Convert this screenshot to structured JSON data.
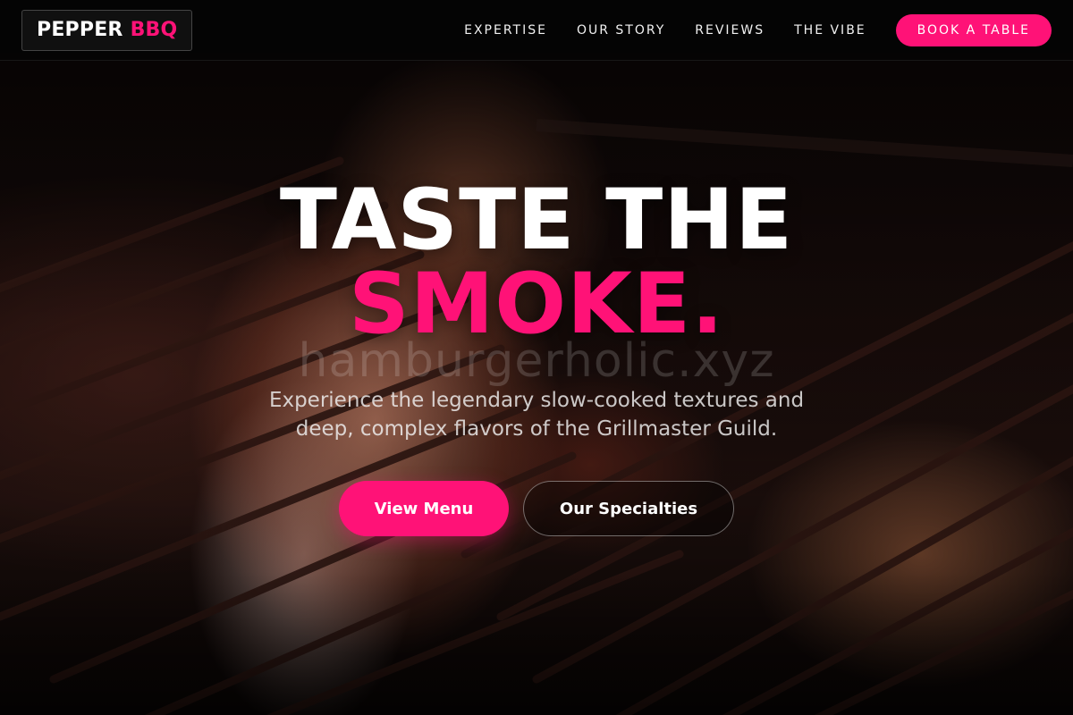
{
  "brand": {
    "name_white": "PEPPER",
    "name_pink": "BBQ"
  },
  "nav": {
    "links": [
      "EXPERTISE",
      "OUR STORY",
      "REVIEWS",
      "THE VIBE"
    ],
    "cta": "BOOK A TABLE"
  },
  "hero": {
    "headline_line1": "TASTE THE",
    "headline_line2": "SMOKE.",
    "watermark": "hamburgerholic.xyz",
    "tagline": "Experience the legendary slow-cooked textures and deep, complex flavors of the Grillmaster Guild.",
    "primary_button": "View Menu",
    "secondary_button": "Our Specialties"
  },
  "colors": {
    "accent": "#ff1277",
    "navbar_bg": "#050505",
    "text": "#ffffff"
  },
  "icons": []
}
